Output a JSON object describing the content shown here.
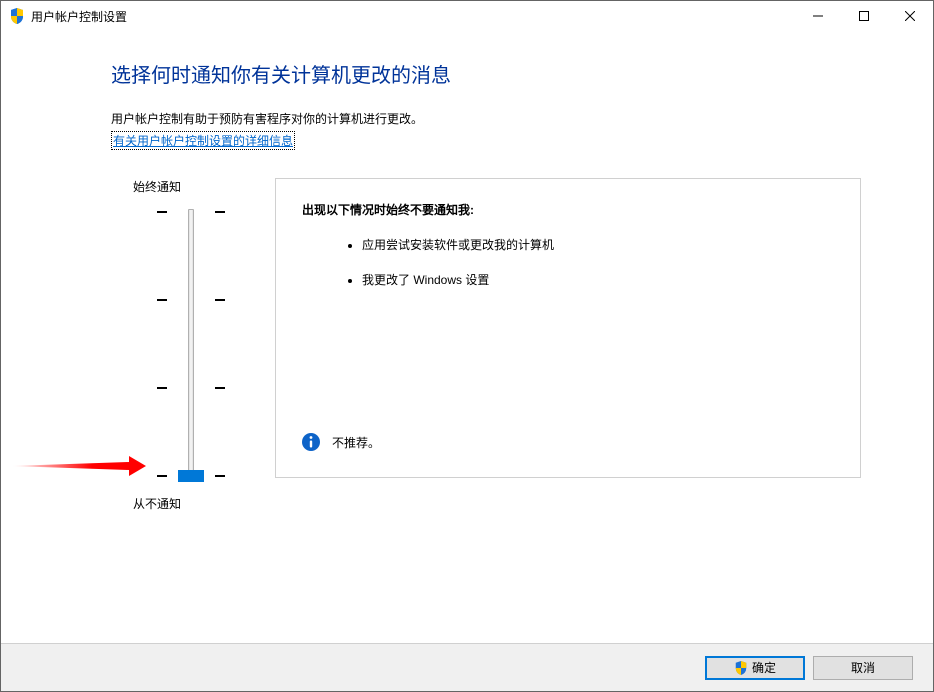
{
  "window": {
    "title": "用户帐户控制设置"
  },
  "content": {
    "heading": "选择何时通知你有关计算机更改的消息",
    "description": "用户帐户控制有助于预防有害程序对你的计算机进行更改。",
    "link": "有关用户帐户控制设置的详细信息"
  },
  "slider": {
    "top_label": "始终通知",
    "bottom_label": "从不通知",
    "levels": 4,
    "current_level": 0
  },
  "info_panel": {
    "title": "出现以下情况时始终不要通知我:",
    "items": [
      "应用尝试安装软件或更改我的计算机",
      "我更改了 Windows 设置"
    ],
    "recommendation": "不推荐。"
  },
  "footer": {
    "ok_label": "确定",
    "cancel_label": "取消"
  }
}
